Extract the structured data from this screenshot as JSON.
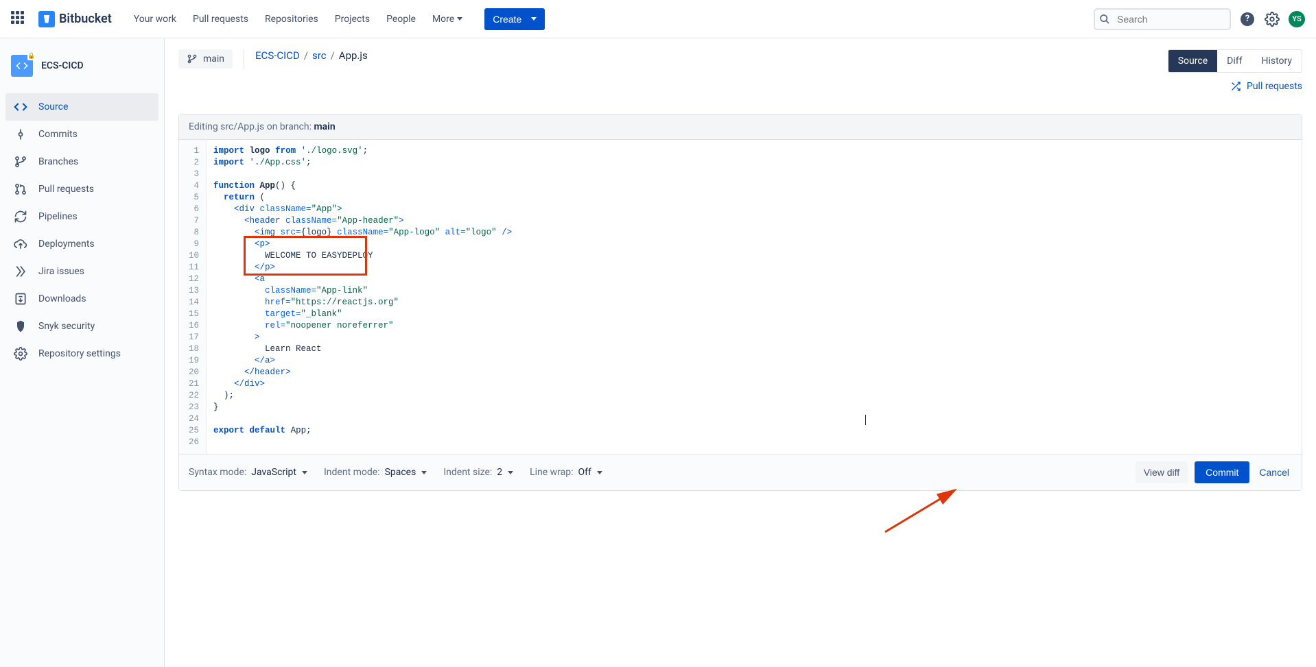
{
  "topnav": {
    "brand": "Bitbucket",
    "items": [
      "Your work",
      "Pull requests",
      "Repositories",
      "Projects",
      "People",
      "More"
    ],
    "create_label": "Create",
    "search_placeholder": "Search",
    "avatar_initials": "YS"
  },
  "sidebar": {
    "repo_name": "ECS-CICD",
    "items": [
      {
        "label": "Source",
        "active": true
      },
      {
        "label": "Commits"
      },
      {
        "label": "Branches"
      },
      {
        "label": "Pull requests"
      },
      {
        "label": "Pipelines"
      },
      {
        "label": "Deployments"
      },
      {
        "label": "Jira issues"
      },
      {
        "label": "Downloads"
      },
      {
        "label": "Snyk security"
      },
      {
        "label": "Repository settings"
      }
    ]
  },
  "toprow": {
    "branch": "main",
    "crumb_repo": "ECS-CICD",
    "crumb_dir": "src",
    "crumb_file": "App.js",
    "tabs": {
      "source": "Source",
      "diff": "Diff",
      "history": "History"
    },
    "pull_requests_label": "Pull requests"
  },
  "editor": {
    "title_prefix": "Editing src/App.js on branch: ",
    "title_branch": "main",
    "lines_count": 26,
    "code": {
      "l1_import": "import",
      "l1_logo": "logo",
      "l1_from": "from",
      "l1_path": "'./logo.svg'",
      "l2_import": "import",
      "l2_path": "'./App.css'",
      "l4_fn": "function",
      "l4_name": "App",
      "l5_return": "return",
      "l6_div_open": "<div",
      "l6_cn": "className=",
      "l6_app": "\"App\"",
      "l7_header_open": "<header",
      "l7_cn": "className=",
      "l7_ah": "\"App-header\"",
      "l8_img": "<img",
      "l8_src": "src=",
      "l8_logo": "{logo}",
      "l8_cn": "className=",
      "l8_al": "\"App-logo\"",
      "l8_alt": "alt=",
      "l8_logotxt": "\"logo\"",
      "l9_p": "<p>",
      "l10_text": "WELCOME TO EASYDEPLOY",
      "l11_pc": "</p>",
      "l12_a": "<a",
      "l13_cn": "className=",
      "l13_al": "\"App-link\"",
      "l14_href": "href=",
      "l14_url": "\"https://reactjs.org\"",
      "l15_target": "target=",
      "l15_blank": "\"_blank\"",
      "l16_rel": "rel=",
      "l16_v": "\"noopener noreferrer\"",
      "l18_learn": "Learn React",
      "l19_ac": "</a>",
      "l20_hc": "</header>",
      "l21_dc": "</div>",
      "l25_export": "export",
      "l25_default": "default",
      "l25_app": "App"
    }
  },
  "bottom": {
    "syntax_label": "Syntax mode:",
    "syntax_value": "JavaScript",
    "indent_mode_label": "Indent mode:",
    "indent_mode_value": "Spaces",
    "indent_size_label": "Indent size:",
    "indent_size_value": "2",
    "linewrap_label": "Line wrap:",
    "linewrap_value": "Off",
    "view_diff": "View diff",
    "commit": "Commit",
    "cancel": "Cancel"
  }
}
